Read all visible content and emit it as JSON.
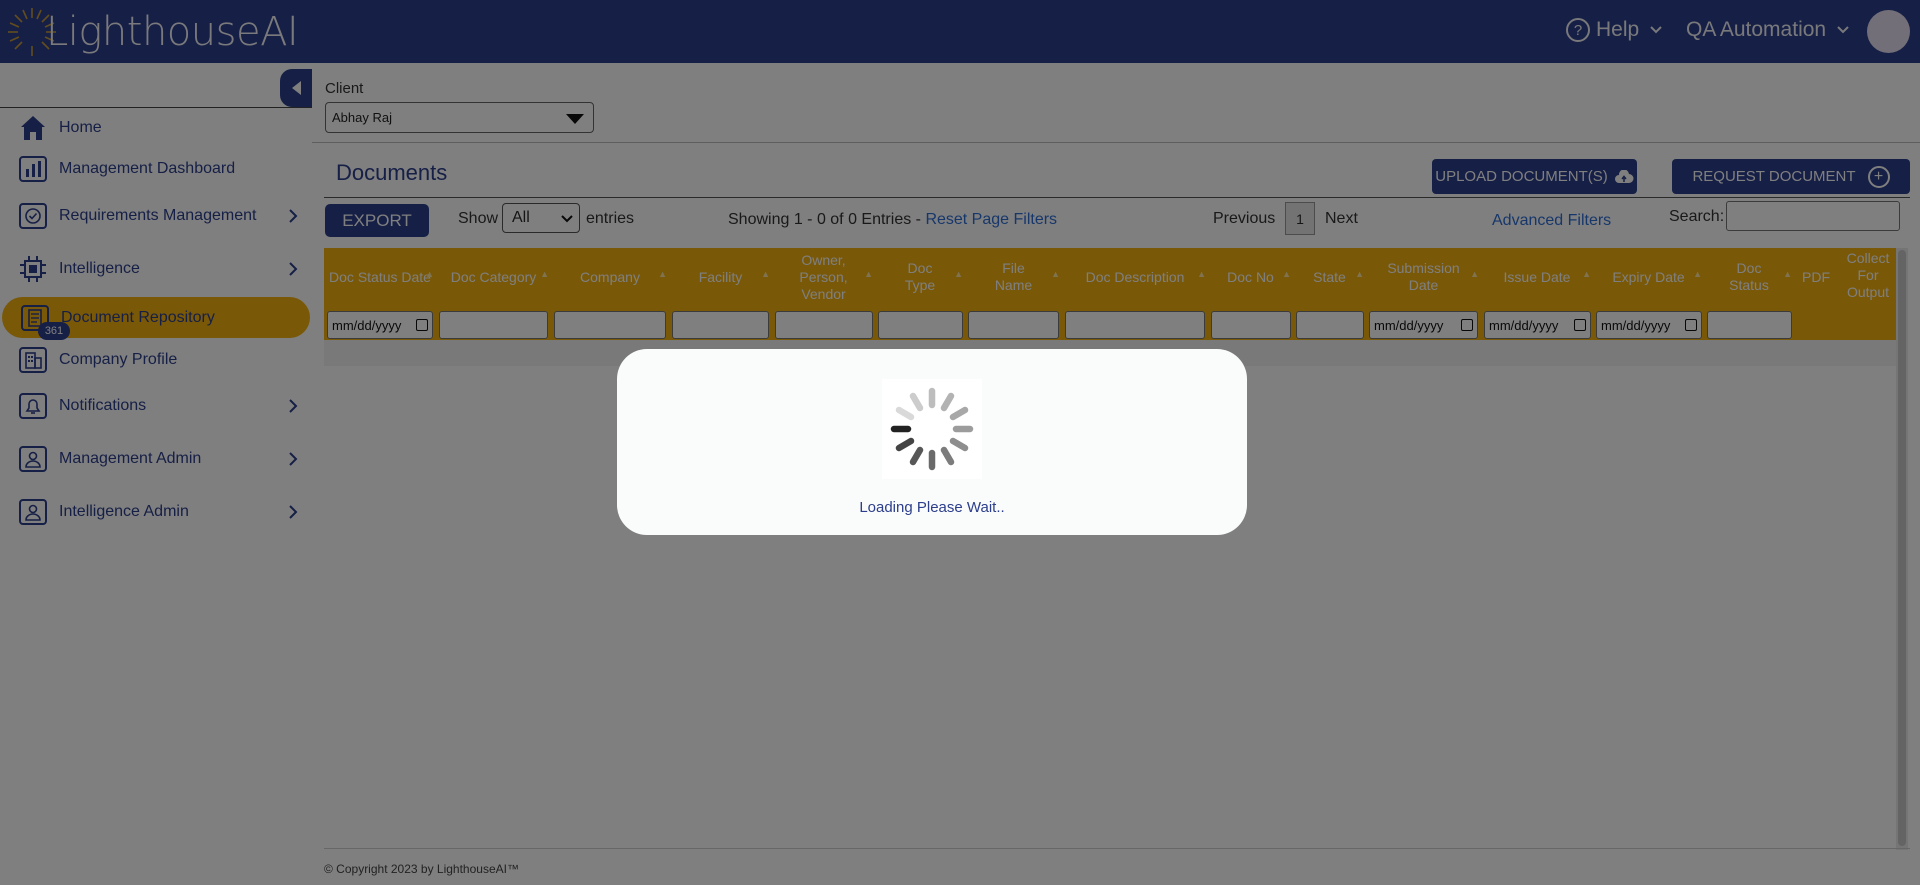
{
  "header": {
    "logo_text": "LighthouseAI",
    "help_label": "Help",
    "user_label": "QA Automation"
  },
  "sidebar": {
    "items": [
      {
        "label": "Home",
        "icon": "home-icon",
        "has_arrow": false,
        "active": false
      },
      {
        "label": "Management Dashboard",
        "icon": "bar-chart-icon",
        "has_arrow": false,
        "active": false
      },
      {
        "label": "Requirements Management",
        "icon": "check-circle-icon",
        "has_arrow": true,
        "active": false
      },
      {
        "label": "Intelligence",
        "icon": "chip-icon",
        "has_arrow": true,
        "active": false
      },
      {
        "label": "Document Repository",
        "icon": "document-icon",
        "has_arrow": false,
        "active": true
      },
      {
        "label": "Company Profile",
        "icon": "building-icon",
        "has_arrow": false,
        "active": false
      },
      {
        "label": "Notifications",
        "icon": "bell-icon",
        "has_arrow": true,
        "active": false,
        "badge": "361"
      },
      {
        "label": "Management Admin",
        "icon": "user-icon",
        "has_arrow": true,
        "active": false
      },
      {
        "label": "Intelligence Admin",
        "icon": "user-icon",
        "has_arrow": true,
        "active": false
      }
    ]
  },
  "client": {
    "label": "Client",
    "value": "Abhay Raj"
  },
  "page": {
    "title": "Documents",
    "upload_label": "UPLOAD DOCUMENT(S)",
    "request_label": "REQUEST DOCUMENT",
    "export_label": "EXPORT",
    "show_label": "Show",
    "entries_value": "All",
    "entries_label": "entries",
    "showing_text": "Showing 1 - 0 of 0 Entries - ",
    "reset_label": "Reset Page Filters",
    "previous_label": "Previous",
    "page_number": "1",
    "next_label": "Next",
    "advanced_label": "Advanced Filters",
    "search_label": "Search:"
  },
  "table": {
    "columns": [
      {
        "label": "Doc Status Date",
        "filter": "mm/dd/yyyy",
        "sortable": true
      },
      {
        "label": "Doc Category",
        "filter": "",
        "sortable": true
      },
      {
        "label": "Company",
        "filter": "",
        "sortable": true
      },
      {
        "label": "Facility",
        "filter": "",
        "sortable": true
      },
      {
        "label": "Owner, Person, Vendor",
        "filter": "",
        "sortable": true
      },
      {
        "label": "Doc Type",
        "filter": "",
        "sortable": true
      },
      {
        "label": "File Name",
        "filter": "",
        "sortable": true
      },
      {
        "label": "Doc Description",
        "filter": "",
        "sortable": true
      },
      {
        "label": "Doc No",
        "filter": "",
        "sortable": true
      },
      {
        "label": "State",
        "filter": "",
        "sortable": true
      },
      {
        "label": "Submission Date",
        "filter": "mm/dd/yyyy",
        "sortable": true
      },
      {
        "label": "Issue Date",
        "filter": "mm/dd/yyyy",
        "sortable": true
      },
      {
        "label": "Expiry Date",
        "filter": "mm/dd/yyyy",
        "sortable": true
      },
      {
        "label": "Doc Status",
        "filter": "",
        "sortable": true
      },
      {
        "label": "PDF",
        "filter": null,
        "sortable": false
      },
      {
        "label": "Collect For Output",
        "filter": null,
        "sortable": false
      }
    ]
  },
  "footer": {
    "copyright": "© Copyright 2023 by LighthouseAI™"
  },
  "modal": {
    "loading_text": "Loading Please Wait.."
  },
  "colors": {
    "primary": "#2c3e8c",
    "accent": "#f3b111",
    "link": "#2f6fd6"
  }
}
